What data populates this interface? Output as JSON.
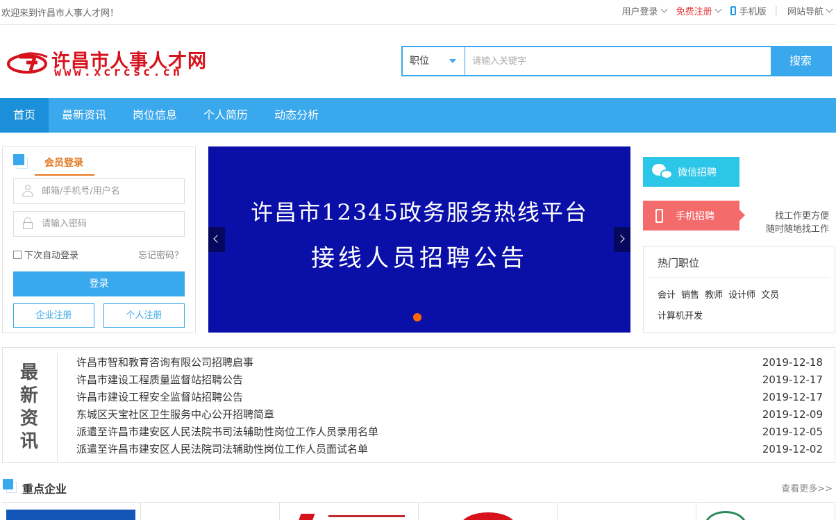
{
  "topbar": {
    "welcome": "欢迎来到许昌市人事人才网！",
    "user_login": "用户登录",
    "free_register": "免费注册",
    "mobile": "手机版",
    "separator": "|",
    "site_nav": "网站导航"
  },
  "logo": {
    "title": "许昌市人事人才网",
    "url": "www.xcrcsc.cn"
  },
  "search": {
    "category": "职位",
    "placeholder": "请输入关键字",
    "button": "搜索"
  },
  "nav": {
    "items": [
      {
        "label": "首页"
      },
      {
        "label": "最新资讯"
      },
      {
        "label": "岗位信息"
      },
      {
        "label": "个人简历"
      },
      {
        "label": "动态分析"
      }
    ]
  },
  "login": {
    "title": "会员登录",
    "username_placeholder": "邮箱/手机号/用户名",
    "password_placeholder": "请输入密码",
    "remember": "下次自动登录",
    "forgot": "忘记密码？",
    "login_button": "登录",
    "company_register": "企业注册",
    "personal_register": "个人注册"
  },
  "banner": {
    "line1": "许昌市12345政务服务热线平台",
    "line2": "接线人员招聘公告",
    "background_color": "#0a0fa8",
    "dot_color": "#ff6600"
  },
  "side": {
    "wechat": "微信招聘",
    "mobile": "手机招聘",
    "slogan1": "找工作更方便",
    "slogan2": "随时随地找工作",
    "hot_title": "热门职位",
    "hot_tags": [
      "会计",
      "销售",
      "教师",
      "设计师",
      "文员",
      "计算机开发"
    ]
  },
  "news": {
    "side_label": [
      "最",
      "新",
      "资",
      "讯"
    ],
    "items": [
      {
        "title": "许昌市智和教育咨询有限公司招聘启事",
        "date": "2019-12-18"
      },
      {
        "title": "许昌市建设工程质量监督站招聘公告",
        "date": "2019-12-17"
      },
      {
        "title": "许昌市建设工程安全监督站招聘公告",
        "date": "2019-12-17"
      },
      {
        "title": "东城区天宝社区卫生服务中心公开招聘简章",
        "date": "2019-12-09"
      },
      {
        "title": "派遣至许昌市建安区人民法院书司法辅助性岗位工作人员录用名单",
        "date": "2019-12-05"
      },
      {
        "title": "派遣至许昌市建安区人民法院司法辅助性岗位工作人员面试名单",
        "date": "2019-12-02"
      }
    ]
  },
  "key_companies": {
    "title": "重点企业",
    "more": "查看更多>>"
  },
  "colors": {
    "accent": "#3aa8ec",
    "brand_red": "#d6121c",
    "login_orange": "#e4751c",
    "wechat": "#2cc6e8",
    "mobile": "#f46b6b"
  }
}
